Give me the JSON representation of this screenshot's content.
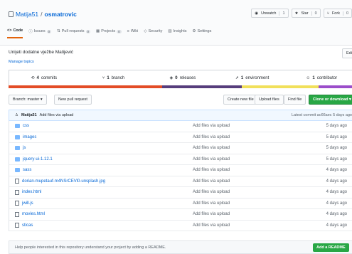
{
  "repo": {
    "owner": "Matija51",
    "separator": "/",
    "name": "osmatrovic"
  },
  "header_buttons": [
    {
      "label": "Unwatch",
      "count": "1"
    },
    {
      "label": "Star",
      "count": "0"
    },
    {
      "label": "Fork",
      "count": "0"
    }
  ],
  "tabs": [
    {
      "label": "Code",
      "count": ""
    },
    {
      "label": "Issues",
      "count": "0"
    },
    {
      "label": "Pull requests",
      "count": "0"
    },
    {
      "label": "Projects",
      "count": "0"
    },
    {
      "label": "Wiki",
      "count": ""
    },
    {
      "label": "Security",
      "count": ""
    },
    {
      "label": "Insights",
      "count": ""
    },
    {
      "label": "Settings",
      "count": ""
    }
  ],
  "description": "Unijeti dodatne vježbe Matijević",
  "manage_topics": "Manage topics",
  "edit_label": "Edit",
  "stats": [
    {
      "num": "4",
      "label": "commits"
    },
    {
      "num": "1",
      "label": "branch"
    },
    {
      "num": "0",
      "label": "releases"
    },
    {
      "num": "1",
      "label": "environment"
    },
    {
      "num": "1",
      "label": "contributor"
    }
  ],
  "language_colors": [
    "#e34c26",
    "#563d7c",
    "#f1e05a",
    "#9b4dca"
  ],
  "toolbar": {
    "branch": "Branch: master ▾",
    "new_pr": "New pull request",
    "create_file": "Create new file",
    "upload": "Upload files",
    "find_file": "Find file",
    "clone": "Clone or download ▾"
  },
  "latest_commit": {
    "author": "Matija51",
    "message": "Add files via upload",
    "meta": "Latest commit ac66aec 5 days ago"
  },
  "files": [
    {
      "type": "dir",
      "name": "css",
      "message": "Add files via upload",
      "age": "5 days ago"
    },
    {
      "type": "dir",
      "name": "images",
      "message": "Add files via upload",
      "age": "5 days ago"
    },
    {
      "type": "dir",
      "name": "js",
      "message": "Add files via upload",
      "age": "5 days ago"
    },
    {
      "type": "dir",
      "name": "jquery-ui-1.12.1",
      "message": "Add files via upload",
      "age": "5 days ago"
    },
    {
      "type": "dir",
      "name": "sass",
      "message": "Add files via upload",
      "age": "4 days ago"
    },
    {
      "type": "file",
      "name": "dorian-mupetauf-m4NSrCEVl0-unsplash.jpg",
      "message": "Add files via upload",
      "age": "4 days ago"
    },
    {
      "type": "file",
      "name": "index.html",
      "message": "Add files via upload",
      "age": "4 days ago"
    },
    {
      "type": "file",
      "name": "jwill.js",
      "message": "Add files via upload",
      "age": "4 days ago"
    },
    {
      "type": "file",
      "name": "movies.html",
      "message": "Add files via upload",
      "age": "4 days ago"
    },
    {
      "type": "file",
      "name": "sticas",
      "message": "Add files via upload",
      "age": "4 days ago"
    }
  ],
  "footer": {
    "text": "Help people interested in this repository understand your project by adding a README.",
    "button": "Add a README"
  }
}
